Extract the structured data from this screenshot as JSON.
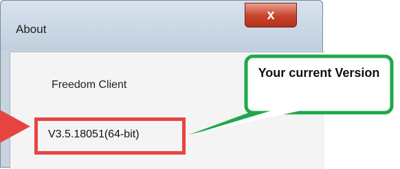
{
  "window": {
    "title": "About",
    "close_glyph": "x"
  },
  "content": {
    "app_name": "Freedom Client",
    "version": "V3.5.18051(64-bit)"
  },
  "callout": {
    "text": "Your current Version"
  },
  "colors": {
    "highlight_red": "#e6453f",
    "callout_green": "#1fa84a",
    "close_red": "#c7422a"
  }
}
